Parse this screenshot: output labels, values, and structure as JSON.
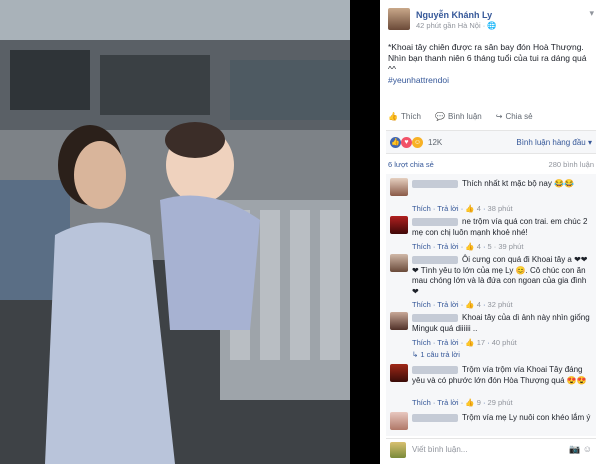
{
  "post": {
    "author": "Nguyễn Khánh Ly",
    "meta": "42 phút gần Hà Nội · 🌐",
    "text": "*Khoai tây chiên được ra sân bay đón Hoà Thượng. Nhìn bạn thanh niên 6 tháng tuổi của tui ra dáng quá ^^",
    "hashtag": "#yeunhattrendoi",
    "options_icon": "chevron-down-icon"
  },
  "actions": {
    "like": "Thích",
    "comment": "Bình luận",
    "share": "Chia sẻ"
  },
  "reactions": {
    "count": "12K",
    "sort": "Bình luận hàng đầu ▾"
  },
  "stats": {
    "shares": "6 lượt chia sẻ",
    "comments": "280 bình luận"
  },
  "comments": [
    {
      "text": "Thích nhất kt mặc bộ nay 😂😂",
      "like": "Thích",
      "reply": "Trả lời",
      "likes": "👍 4",
      "time": "38 phút"
    },
    {
      "text": "ne trộm vía quá con trai. em chúc 2 mẹ con chị luôn mạnh khoẻ nhé!",
      "like": "Thích",
      "reply": "Trả lời",
      "likes": "👍 4",
      "time": "5 · 39 phút"
    },
    {
      "text": "Ôi cưng con quá đi Khoai tây a ❤❤❤ Tình yêu to lớn của mẹ Ly 😊. Cô chúc con ăn mau chóng lớn và là đứa con ngoan của gia đình ❤",
      "like": "Thích",
      "reply": "Trả lời",
      "likes": "👍 4",
      "time": "32 phút"
    },
    {
      "text": "Khoai tây của dì ảnh này nhìn giống Minguk quá diiiiii ..",
      "like": "Thích",
      "reply": "Trả lời",
      "likes": "👍 17",
      "time": "40 phút"
    },
    {
      "text": "Trộm vía trộm vía Khoai Tây đáng yêu và có phước lớn đón Hòa Thượng quá 😍😍",
      "like": "Thích",
      "reply": "Trả lời",
      "likes": "👍 9",
      "time": "29 phút"
    },
    {
      "text": "Trộm vía mẹ Ly nuôi con khéo lắm ý",
      "like": "Thích",
      "reply": "Trả lời",
      "likes": "👍 1",
      "time": ""
    }
  ],
  "reply_more": "↳ 1 câu trả lời",
  "composer": {
    "placeholder": "Viết bình luận...",
    "camera": "📷",
    "emoji": "☺"
  }
}
